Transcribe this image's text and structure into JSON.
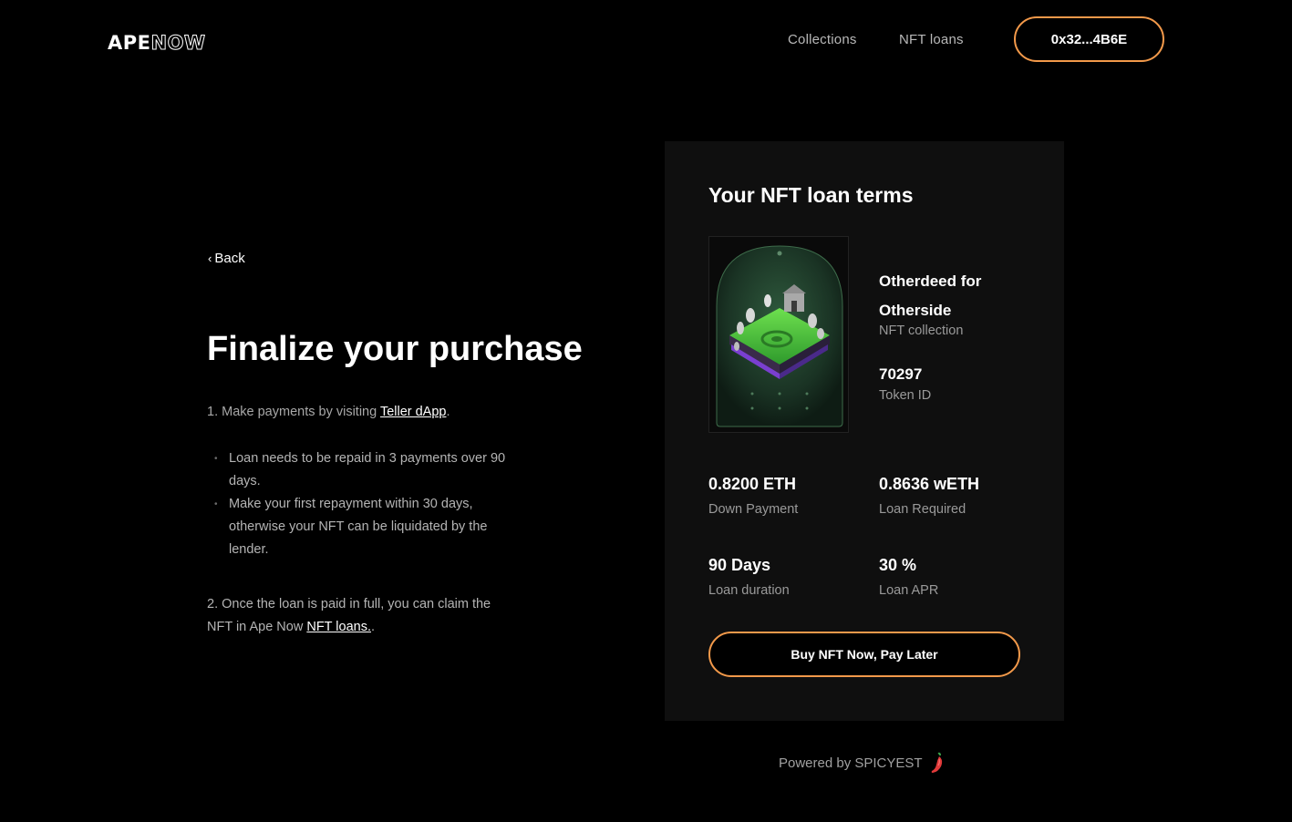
{
  "header": {
    "logo_bold": "APE",
    "logo_outline": "NOW",
    "nav": [
      {
        "label": "Collections"
      },
      {
        "label": "NFT loans"
      }
    ],
    "wallet_label": "0x32...4B6E"
  },
  "main": {
    "back_label": "Back",
    "title": "Finalize your purchase",
    "step1_prefix": "1. Make payments by visiting ",
    "step1_link": "Teller dApp",
    "step1_suffix": ".",
    "bullets": [
      "Loan needs to be repaid in 3 payments over 90 days.",
      "Make your first repayment within 30 days, otherwise your NFT can be liquidated by the lender."
    ],
    "step2_prefix": "2. Once the loan is paid in full, you can claim the NFT in Ape Now ",
    "step2_link": "NFT loans.",
    "step2_suffix": "."
  },
  "card": {
    "title": "Your NFT loan terms",
    "collection_name": "Otherdeed for Otherside",
    "collection_label": "NFT collection",
    "token_id": "70297",
    "token_label": "Token ID",
    "stats": [
      {
        "value": "0.8200 ETH",
        "label": "Down Payment"
      },
      {
        "value": "0.8636 wETH",
        "label": "Loan Required"
      },
      {
        "value": "90 Days",
        "label": "Loan duration"
      },
      {
        "value": "30 %",
        "label": "Loan APR"
      }
    ],
    "buy_label": "Buy NFT Now, Pay Later"
  },
  "footer": {
    "powered_by": "Powered by SPICYEST",
    "icon": "chili-pepper-icon"
  },
  "colors": {
    "accent": "#f2994a",
    "background": "#000000",
    "card_background": "#0f0f0f",
    "muted_text": "#9a9a9a"
  }
}
